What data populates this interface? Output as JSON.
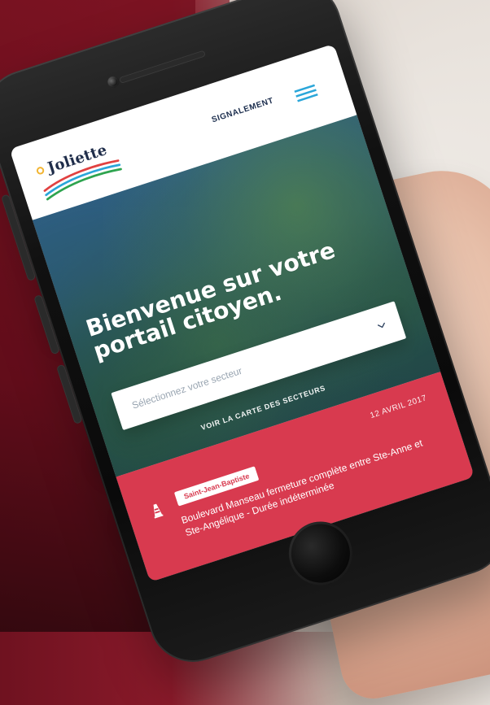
{
  "app": {
    "brand_name": "Joliette",
    "header": {
      "signalement_label": "SIGNALEMENT"
    }
  },
  "hero": {
    "title_line_1": "Bienvenue sur votre",
    "title_line_2": "portail citoyen.",
    "sector_placeholder": "Sélectionnez votre secteur",
    "map_link_label": "VOIR LA CARTE DES SECTEURS"
  },
  "alert": {
    "date": "12 AVRIL 2017",
    "tag": "Saint-Jean-Baptiste",
    "text": "Boulevard Manseau fermeture complète entre Ste-Anne et Ste-Angélique - Durée indéterminée"
  },
  "icons": {
    "menu": "menu-icon",
    "select_chevron": "chevron-down-icon",
    "cone": "traffic-cone-icon"
  },
  "colors": {
    "brand_navy": "#1b2d4d",
    "alert_red": "#d83a4f",
    "hero_blue": "#2f5f86"
  }
}
